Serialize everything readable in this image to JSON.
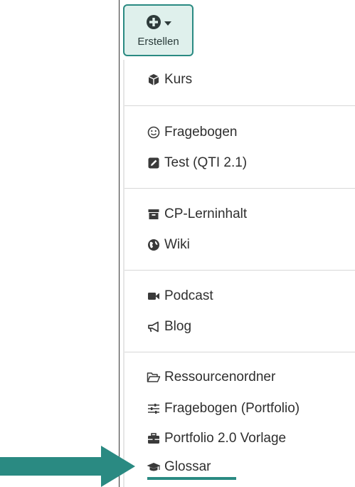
{
  "create_button": {
    "label": "Erstellen",
    "icon": "plus-circle-icon",
    "caret": "caret-down-icon",
    "accent": "#2a8a82"
  },
  "menu": {
    "groups": [
      [
        {
          "label": "Kurs",
          "icon": "cube-icon"
        }
      ],
      [
        {
          "label": "Fragebogen",
          "icon": "smiley-icon"
        },
        {
          "label": "Test (QTI 2.1)",
          "icon": "edit-square-icon"
        }
      ],
      [
        {
          "label": "CP-Lerninhalt",
          "icon": "archive-icon"
        },
        {
          "label": "Wiki",
          "icon": "globe-icon"
        }
      ],
      [
        {
          "label": "Podcast",
          "icon": "video-camera-icon"
        },
        {
          "label": "Blog",
          "icon": "bullhorn-icon"
        }
      ],
      [
        {
          "label": "Ressourcenordner",
          "icon": "folder-open-icon"
        },
        {
          "label": "Fragebogen (Portfolio)",
          "icon": "sliders-icon"
        },
        {
          "label": "Portfolio 2.0 Vorlage",
          "icon": "briefcase-icon"
        },
        {
          "label": "Glossar",
          "icon": "graduation-cap-icon"
        }
      ]
    ]
  },
  "highlight": {
    "target": "Glossar",
    "color": "#2a8a82"
  }
}
